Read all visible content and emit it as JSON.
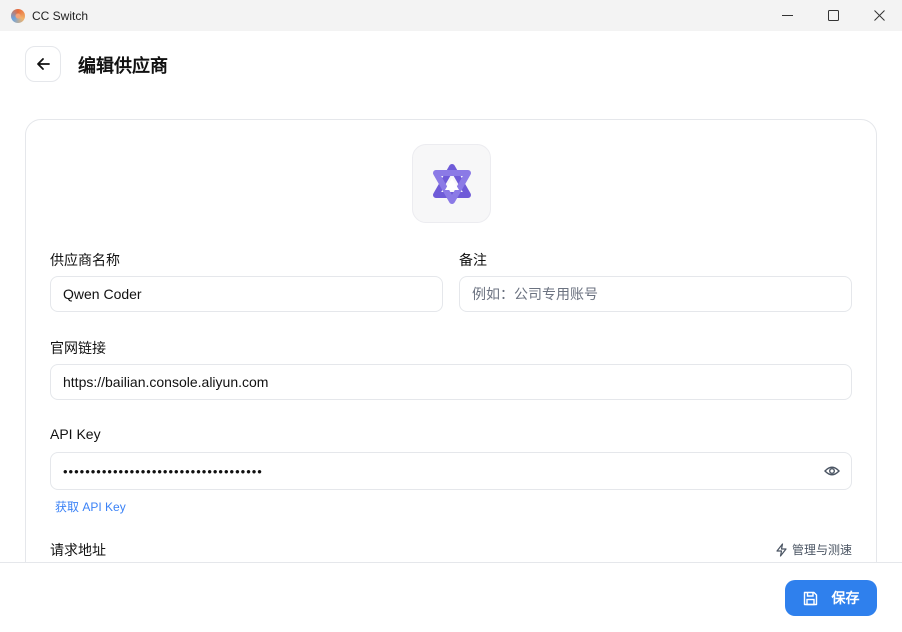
{
  "window": {
    "title": "CC Switch"
  },
  "header": {
    "title": "编辑供应商"
  },
  "form": {
    "provider_name": {
      "label": "供应商名称",
      "value": "Qwen Coder"
    },
    "note": {
      "label": "备注",
      "placeholder": "例如：公司专用账号"
    },
    "website": {
      "label": "官网链接",
      "value": "https://bailian.console.aliyun.com"
    },
    "api_key": {
      "label": "API Key",
      "value": "••••••••••••••••••••••••••••••••••••",
      "get_link": "获取 API Key"
    },
    "endpoint": {
      "label": "请求地址",
      "manage_label": "管理与测速"
    }
  },
  "footer": {
    "save_label": "保存"
  },
  "colors": {
    "accent": "#2f80ed",
    "logo": "#6f5bd8"
  },
  "icons": [
    "app-logo-icon",
    "minimize-icon",
    "maximize-icon",
    "close-icon",
    "back-arrow-icon",
    "qwen-logo-icon",
    "eye-icon",
    "lightning-icon",
    "save-icon"
  ]
}
